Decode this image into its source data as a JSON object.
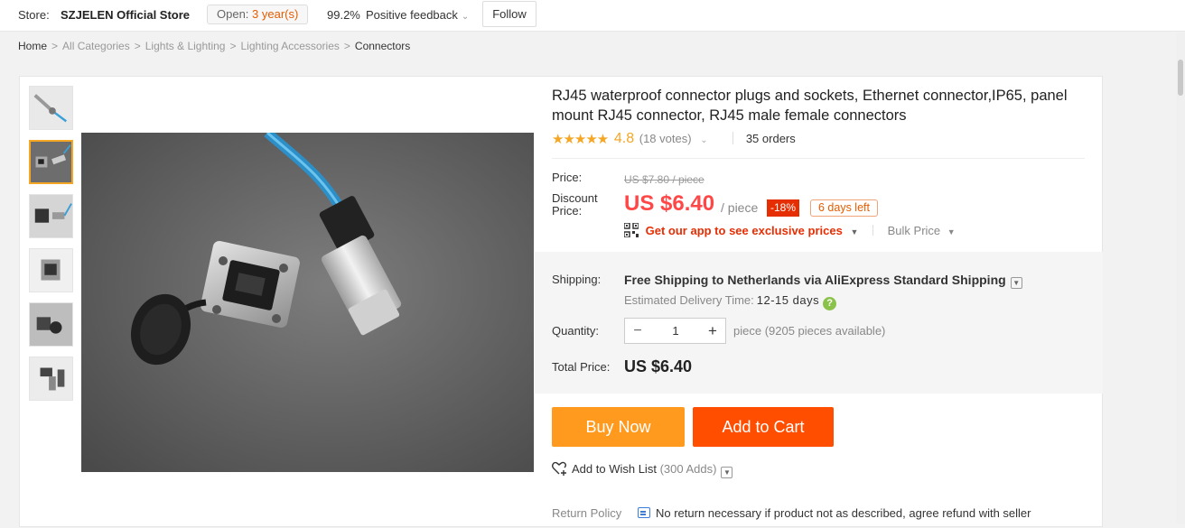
{
  "store_bar": {
    "store_label": "Store:",
    "store_name": "SZJELEN Official Store",
    "open_label": "Open:",
    "open_years": "3 year(s)",
    "feedback_pct": "99.2%",
    "feedback_label": "Positive feedback",
    "follow_label": "Follow"
  },
  "breadcrumb": [
    "Home",
    "All Categories",
    "Lights & Lighting",
    "Lighting Accessories",
    "Connectors"
  ],
  "gallery": {
    "thumbnails": [
      "connector-cable",
      "panel-socket-with-plug",
      "socket-and-plug-pair",
      "panel-socket-front",
      "socket-side-view",
      "plug-assembly-parts"
    ],
    "active_index": 1
  },
  "product": {
    "title": "RJ45 waterproof connector plugs and sockets, Ethernet connector,IP65, panel mount RJ45 connector, RJ45 male female connectors",
    "stars": "★★★★★",
    "rating": "4.8",
    "votes": "(18 votes)",
    "orders": "35 orders"
  },
  "pricing": {
    "price_label": "Price:",
    "old_price": "US $7.80 / piece",
    "discount_label": "Discount Price:",
    "new_price": "US $6.40",
    "per_piece": "/ piece",
    "discount_badge": "-18%",
    "days_left": "6 days left",
    "app_promo": "Get our app to see exclusive prices",
    "bulk_price": "Bulk Price"
  },
  "shipping": {
    "label": "Shipping:",
    "value": "Free Shipping to Netherlands via AliExpress Standard Shipping",
    "est_label": "Estimated Delivery Time:",
    "est_value": "12-15 days",
    "help": "?"
  },
  "quantity": {
    "label": "Quantity:",
    "minus": "−",
    "value": "1",
    "plus": "+",
    "available": "piece (9205 pieces available)"
  },
  "total": {
    "label": "Total Price:",
    "value": "US $6.40"
  },
  "actions": {
    "buy_now": "Buy Now",
    "add_to_cart": "Add to Cart",
    "wishlist": "Add to Wish List",
    "wish_count": "(300 Adds)"
  },
  "return_policy": {
    "label": "Return Policy",
    "value": "No return necessary if product not as described, agree refund with seller"
  },
  "colors": {
    "price_red": "#ff4747",
    "buy_orange": "#ff9a1f",
    "cart_orange": "#ff4e00",
    "star_gold": "#f5a623"
  }
}
